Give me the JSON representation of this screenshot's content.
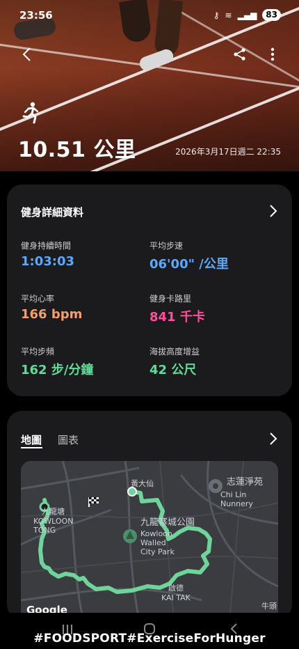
{
  "status_bar": {
    "time": "23:56",
    "battery": "83"
  },
  "header": {
    "distance": "10.51 公里",
    "datetime": "2026年3月17日週二 22:35",
    "icons": [
      "back-arrow-icon",
      "share-icon",
      "more-vert-icon",
      "runner-icon"
    ]
  },
  "details": {
    "title": "健身詳細資料",
    "metrics": [
      {
        "label": "健身持續時間",
        "value": "1:03:03",
        "color": "#5aa9ff"
      },
      {
        "label": "平均步速",
        "value": "06'00\" /公里",
        "color": "#5aa9ff"
      },
      {
        "label": "平均心率",
        "value": "166 bpm",
        "color": "#f5a06b"
      },
      {
        "label": "健身卡路里",
        "value": "841 千卡",
        "color": "#ff4f9a"
      },
      {
        "label": "平均步頻",
        "value": "162 步/分鐘",
        "color": "#5fdc9a"
      },
      {
        "label": "海拔高度增益",
        "value": "42 公尺",
        "color": "#5fdc9a"
      }
    ]
  },
  "map_card": {
    "tabs": [
      "地圖",
      "圖表"
    ],
    "active_tab": "地圖",
    "route_color": "#6fd49a",
    "labels": {
      "wong_tai_sin": "黃大仙",
      "kowloon_tong_cn": "九龍塘",
      "kowloon_tong_en": "KOWLOON\nTONG",
      "chi_lin_cn": "志蓮淨苑",
      "chi_lin_en": "Chi Lin Nunnery",
      "walled_city_cn": "九龍寨城公園",
      "walled_city_en": "Kowloon\nWalled\nCity Park",
      "kai_tak_cn": "啟德",
      "kai_tak_en": "KAI TAK",
      "ngau_tau": "牛頭",
      "google": "Google"
    }
  },
  "footer": {
    "hashtag": "#FOODSPORT#ExerciseForHunger"
  }
}
